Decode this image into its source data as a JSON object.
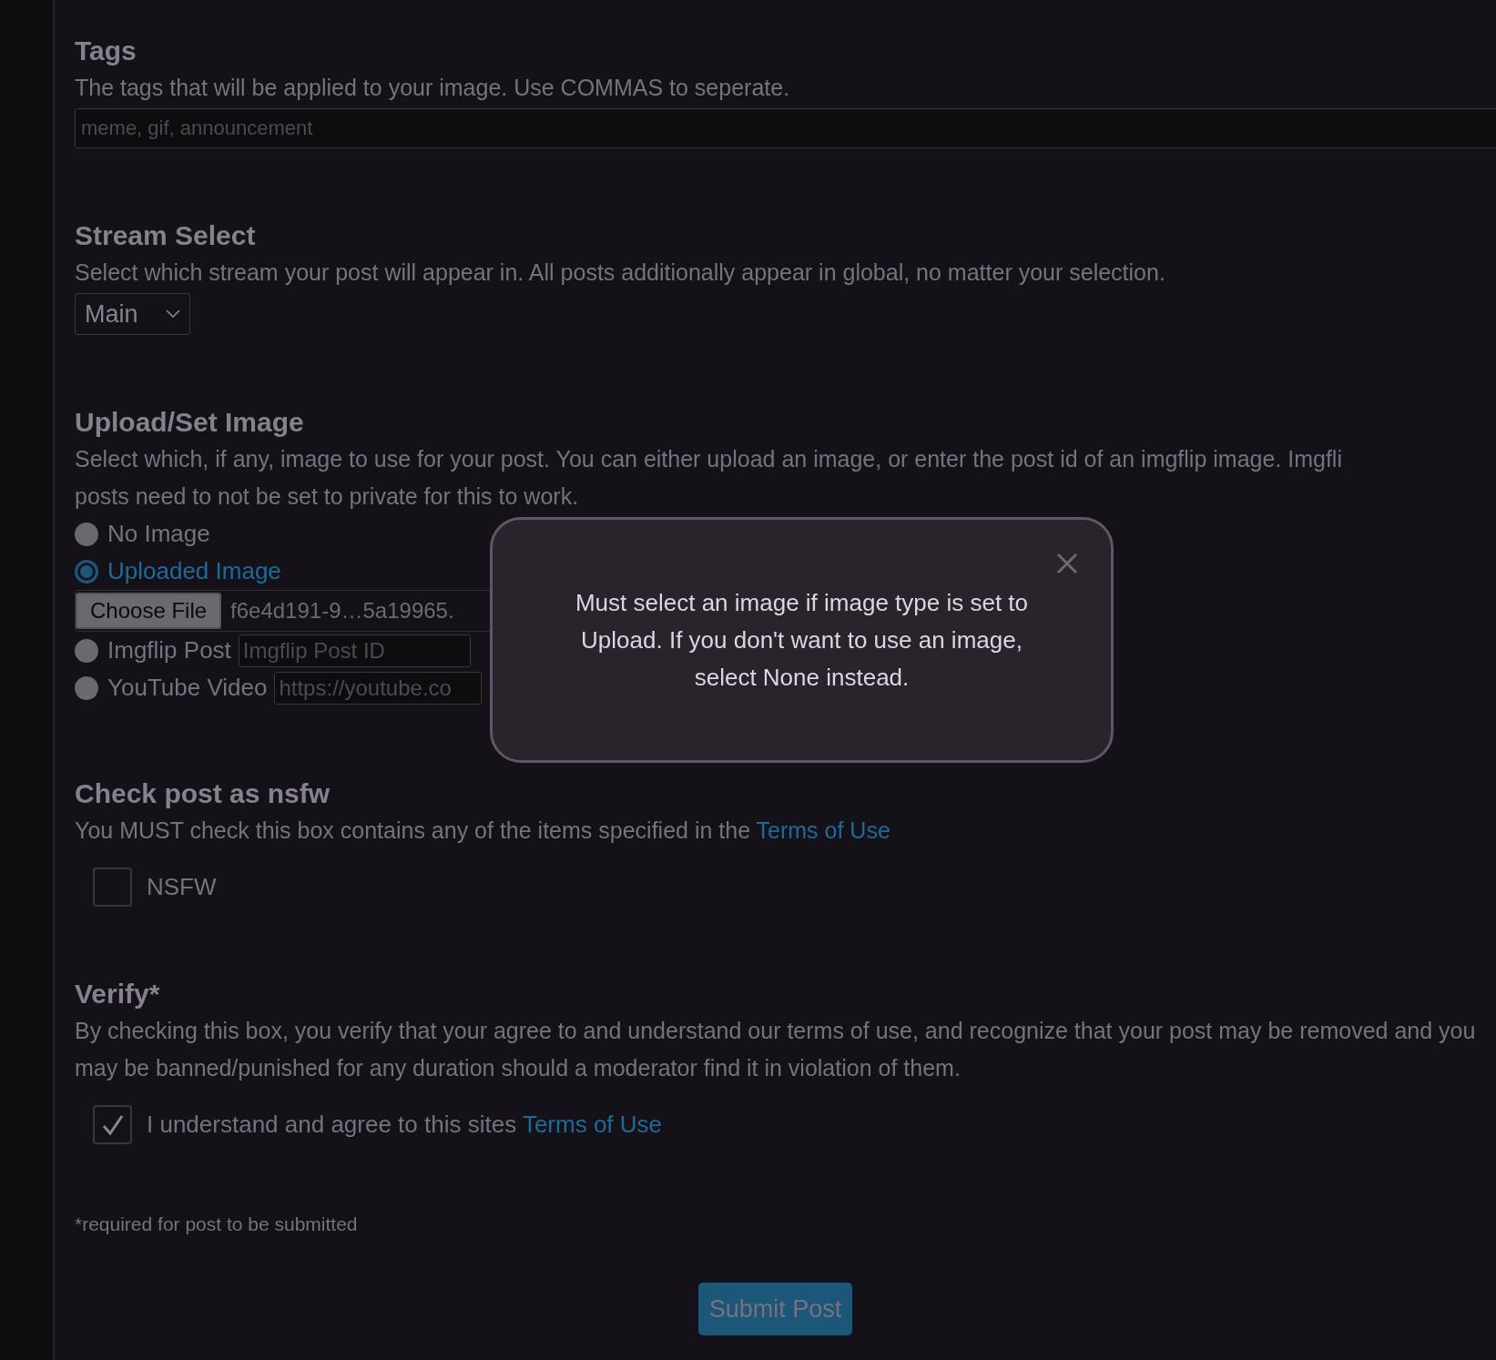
{
  "tags": {
    "heading": "Tags",
    "description": "The tags that will be applied to your image. Use COMMAS to seperate.",
    "placeholder": "meme, gif, announcement"
  },
  "stream": {
    "heading": "Stream Select",
    "description": "Select which stream your post will appear in. All posts additionally appear in global, no matter your selection.",
    "value": "Main"
  },
  "image": {
    "heading": "Upload/Set Image",
    "description": [
      "Select which, if any, image to use for your post. You can either upload an image, or enter the post id of an imgflip image. Imgfli",
      "posts need to not be set to private for this to work."
    ],
    "options": [
      {
        "kind": "none",
        "label": "No Image",
        "selected": false
      },
      {
        "kind": "upload",
        "label": "Uploaded Image",
        "selected": true,
        "button": "Choose File",
        "file": "f6e4d191-9…5a19965."
      },
      {
        "kind": "imgflip",
        "label": "Imgflip Post",
        "selected": false,
        "placeholder": "Imgflip Post ID"
      },
      {
        "kind": "youtube",
        "label": "YouTube Video",
        "selected": false,
        "placeholder": "https://youtube.co"
      }
    ]
  },
  "nsfw": {
    "heading": "Check post as nsfw",
    "description": "You MUST check this box contains any of the items specified in the",
    "link": "Terms of Use",
    "checkbox": {
      "label": "NSFW",
      "checked": false
    }
  },
  "verify": {
    "heading": "Verify*",
    "description": "By checking this box, you verify that your agree to and understand our terms of use, and recognize that your post may be removed and you may be banned/punished for any duration should a moderator find it in violation of them.",
    "checkbox": {
      "label": "I understand and agree to this sites",
      "link": "Terms of Use",
      "checked": true
    }
  },
  "footnote": "*required for post to be submitted",
  "submit": "Submit Post",
  "modal": {
    "message": "Must select an image if image type is set to Upload. If you don't want to use an image, select None instead."
  }
}
